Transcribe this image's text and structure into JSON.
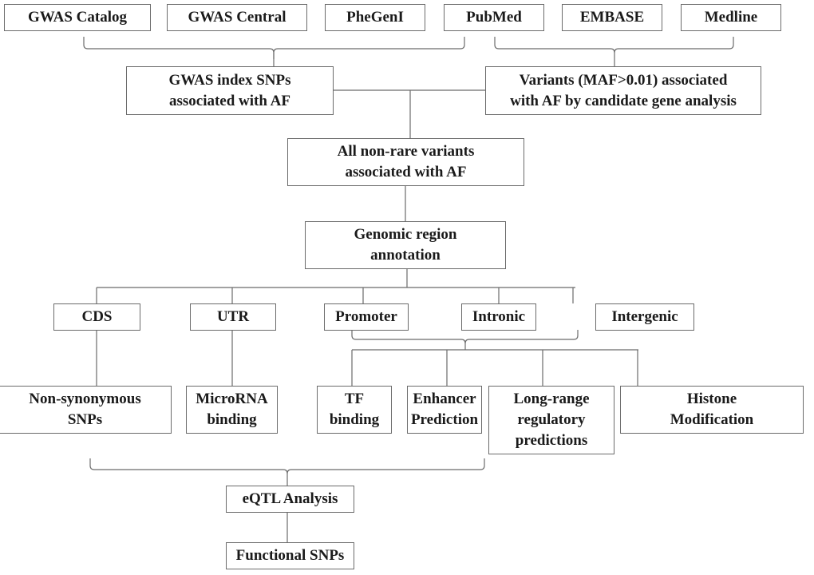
{
  "diagram": {
    "type": "flowchart",
    "sources": [
      {
        "id": "gwas-catalog",
        "label": "GWAS Catalog"
      },
      {
        "id": "gwas-central",
        "label": "GWAS Central"
      },
      {
        "id": "phegeni",
        "label": "PheGenI"
      },
      {
        "id": "pubmed",
        "label": "PubMed"
      },
      {
        "id": "embase",
        "label": "EMBASE"
      },
      {
        "id": "medline",
        "label": "Medline"
      }
    ],
    "gwas_index": {
      "label": "GWAS index SNPs\nassociated with AF"
    },
    "candidate_variants": {
      "label": "Variants (MAF>0.01) associated\nwith AF by candidate gene analysis"
    },
    "all_variants": {
      "label": "All non-rare variants\nassociated with AF"
    },
    "genomic_annotation": {
      "label": "Genomic region\nannotation"
    },
    "regions": [
      {
        "id": "cds",
        "label": "CDS"
      },
      {
        "id": "utr",
        "label": "UTR"
      },
      {
        "id": "promoter",
        "label": "Promoter"
      },
      {
        "id": "intronic",
        "label": "Intronic"
      },
      {
        "id": "intergenic",
        "label": "Intergenic"
      }
    ],
    "analyses": [
      {
        "id": "non-synonymous",
        "label": "Non-synonymous\nSNPs"
      },
      {
        "id": "microrna",
        "label": "MicroRNA\nbinding"
      },
      {
        "id": "tf-binding",
        "label": "TF\nbinding"
      },
      {
        "id": "enhancer",
        "label": "Enhancer\nPrediction"
      },
      {
        "id": "long-range",
        "label": "Long-range\nregulatory\npredictions"
      },
      {
        "id": "histone",
        "label": "Histone\nModification"
      }
    ],
    "eqtl": {
      "label": "eQTL Analysis"
    },
    "functional": {
      "label": "Functional SNPs"
    },
    "edges": [
      {
        "from": [
          "gwas-catalog",
          "gwas-central",
          "phegeni",
          "pubmed"
        ],
        "to": "gwas_index",
        "style": "brace"
      },
      {
        "from": [
          "pubmed",
          "embase",
          "medline"
        ],
        "to": "candidate_variants",
        "style": "brace"
      },
      {
        "from": [
          "gwas_index",
          "candidate_variants"
        ],
        "to": "all_variants"
      },
      {
        "from": "all_variants",
        "to": "genomic_annotation"
      },
      {
        "from": "genomic_annotation",
        "to": [
          "cds",
          "utr",
          "promoter",
          "intronic",
          "intergenic"
        ]
      },
      {
        "from": "cds",
        "to": "non-synonymous"
      },
      {
        "from": "utr",
        "to": "microrna"
      },
      {
        "from": [
          "promoter",
          "intronic",
          "intergenic"
        ],
        "to": [
          "tf-binding",
          "enhancer",
          "long-range",
          "histone"
        ],
        "style": "brace"
      },
      {
        "from": [
          "non-synonymous",
          "microrna",
          "tf-binding",
          "enhancer",
          "long-range",
          "histone"
        ],
        "to": "eqtl",
        "style": "brace"
      },
      {
        "from": "eqtl",
        "to": "functional"
      }
    ],
    "colors": {
      "stroke": "#6b6b6b",
      "text": "#1a1a1a",
      "background": "#ffffff"
    }
  }
}
